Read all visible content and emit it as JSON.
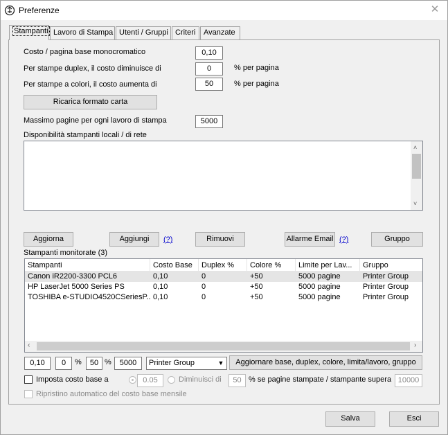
{
  "window": {
    "title": "Preferenze",
    "close_glyph": "✕"
  },
  "tabs": [
    {
      "label": "Stampanti",
      "active": true
    },
    {
      "label": "Lavoro di Stampa"
    },
    {
      "label": "Utenti / Gruppi"
    },
    {
      "label": "Criteri"
    },
    {
      "label": "Avanzate"
    }
  ],
  "settings": {
    "cost_base_label": "Costo / pagina base monocromatico",
    "cost_base_value": "0,10",
    "duplex_label": "Per stampe duplex, il costo diminuisce di",
    "duplex_value": "0",
    "duplex_unit": "% per pagina",
    "color_label": "Per stampe a colori, il costo aumenta di",
    "color_value": "50",
    "color_unit": "% per pagina",
    "reload_paper_button": "Ricarica formato carta",
    "max_pages_label": "Massimo pagine per ogni lavoro di stampa",
    "max_pages_value": "5000",
    "available_printers_label": "Disponibilità stampanti locali / di rete"
  },
  "actions": {
    "refresh": "Aggiorna",
    "add": "Aggiungi",
    "help1": "(?)",
    "remove": "Rimuovi",
    "email_alarm": "Allarme Email",
    "help2": "(?)",
    "group": "Gruppo"
  },
  "monitored": {
    "label": "Stampanti monitorate (3)",
    "columns": [
      "Stampanti",
      "Costo Base",
      "Duplex %",
      "Colore %",
      "Limite per Lav...",
      "Gruppo"
    ],
    "rows": [
      [
        "Canon iR2200-3300 PCL6",
        "0,10",
        "0",
        "+50",
        "5000 pagine",
        "Printer Group"
      ],
      [
        "HP LaserJet 5000 Series PS",
        "0,10",
        "0",
        "+50",
        "5000 pagine",
        "Printer Group"
      ],
      [
        "TOSHIBA e-STUDIO4520CSeriesP...",
        "0,10",
        "0",
        "+50",
        "5000 pagine",
        "Printer Group"
      ]
    ]
  },
  "bulk_edit": {
    "cost": "0,10",
    "duplex": "0",
    "duplex_unit": "%",
    "color": "50",
    "color_unit": "%",
    "limit": "5000",
    "group": "Printer Group",
    "apply_button": "Aggiornare base, duplex, colore, limita/lavoro, gruppo"
  },
  "options": {
    "set_base_label": "Imposta costo base a",
    "set_base_value": "0.05",
    "decrease_label": "Diminuisci di",
    "decrease_value": "50",
    "threshold_label": "% se pagine stampate / stampante supera",
    "threshold_value": "10000",
    "monthly_reset_label": "Ripristino automatico del costo base mensile"
  },
  "footer": {
    "save": "Salva",
    "exit": "Esci"
  },
  "colors": {
    "selected_row": "#e5e5e5",
    "link": "#0000cc"
  }
}
